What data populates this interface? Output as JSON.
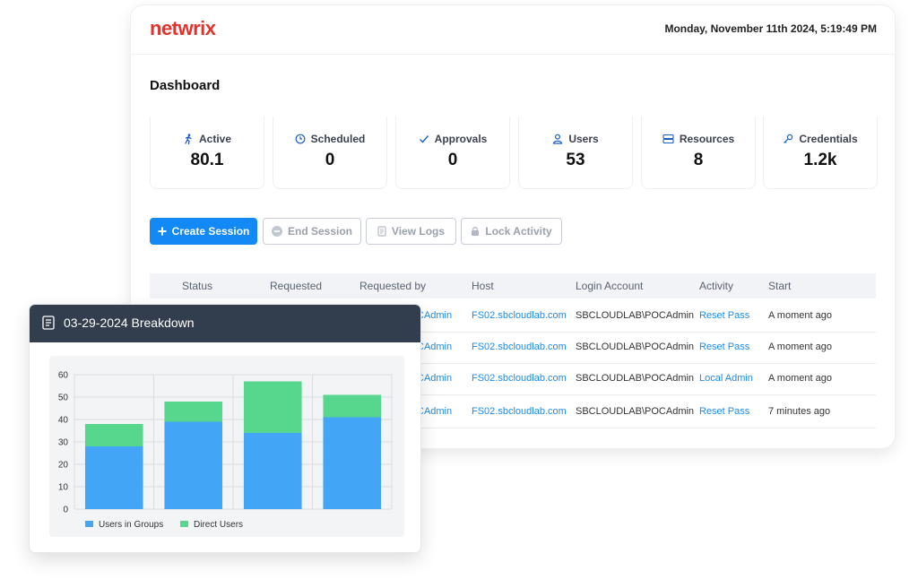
{
  "header": {
    "logo": "netwrix",
    "datetime": "Monday, November 11th 2024, 5:19:49 PM"
  },
  "dashboard": {
    "title": "Dashboard"
  },
  "stats": [
    {
      "label": "Active",
      "value": "80.1",
      "icon": "running-person-icon"
    },
    {
      "label": "Scheduled",
      "value": "0",
      "icon": "clock-icon"
    },
    {
      "label": "Approvals",
      "value": "0",
      "icon": "checkmark-icon"
    },
    {
      "label": "Users",
      "value": "53",
      "icon": "user-icon"
    },
    {
      "label": "Resources",
      "value": "8",
      "icon": "server-icon"
    },
    {
      "label": "Credentials",
      "value": "1.2k",
      "icon": "key-icon"
    }
  ],
  "actions": {
    "create_session": "Create Session",
    "end_session": "End Session",
    "view_logs": "View Logs",
    "lock_activity": "Lock Activity"
  },
  "table": {
    "columns": [
      "Status",
      "Requested",
      "Requested by",
      "Host",
      "Login Account",
      "Activity",
      "Start"
    ],
    "rows": [
      {
        "requested_by": "CAdmin",
        "host": "FS02.sbcloudlab.com",
        "login_account": "SBCLOUDLAB\\POCAdmin",
        "activity": "Reset Pass",
        "start": "A moment ago"
      },
      {
        "requested_by": "CAdmin",
        "host": "FS02.sbcloudlab.com",
        "login_account": "SBCLOUDLAB\\POCAdmin",
        "activity": "Reset Pass",
        "start": "A moment ago"
      },
      {
        "requested_by": "CAdmin",
        "host": "FS02.sbcloudlab.com",
        "login_account": "SBCLOUDLAB\\POCAdmin",
        "activity": "Local Admin",
        "start": "A moment ago"
      },
      {
        "requested_by": "CAdmin",
        "host": "FS02.sbcloudlab.com",
        "login_account": "SBCLOUDLAB\\POCAdmin",
        "activity": "Reset Pass",
        "start": "7 minutes ago"
      }
    ]
  },
  "breakdown": {
    "title": "03-29-2024 Breakdown"
  },
  "chart_data": {
    "type": "bar",
    "stacked": true,
    "categories": [
      "",
      "",
      "",
      ""
    ],
    "series": [
      {
        "name": "Users in Groups",
        "values": [
          28,
          39,
          34,
          41
        ],
        "color": "#42a5f5"
      },
      {
        "name": "Direct Users",
        "values": [
          10,
          9,
          23,
          10
        ],
        "color": "#57d68d"
      }
    ],
    "yticks": [
      0,
      10,
      20,
      30,
      40,
      50,
      60
    ],
    "ylim": [
      0,
      60
    ],
    "grid": true,
    "legend": "bottom-left"
  }
}
